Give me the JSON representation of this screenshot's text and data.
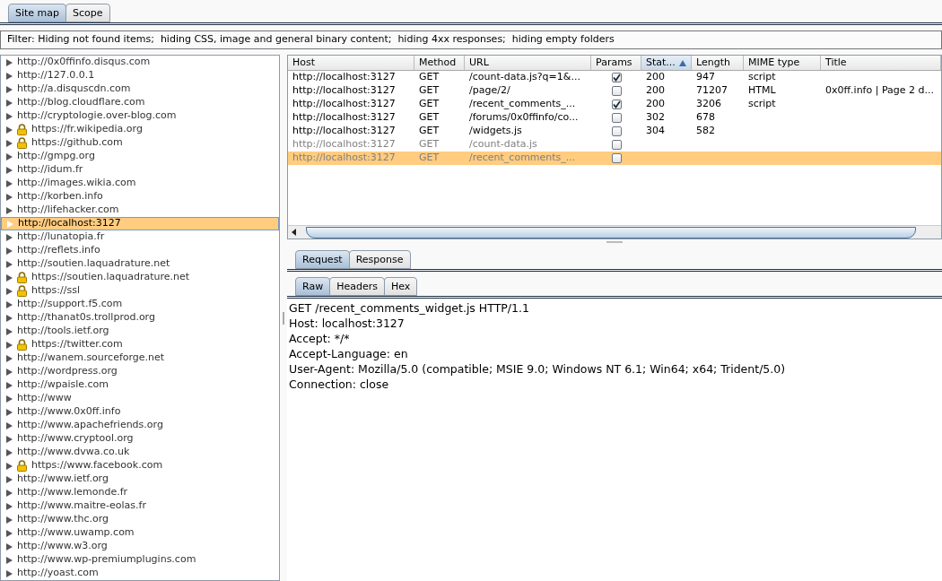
{
  "tabs": [
    {
      "label": "Site map",
      "selected": true
    },
    {
      "label": "Scope",
      "selected": false
    }
  ],
  "filter": "Filter: Hiding not found items;  hiding CSS, image and general binary content;  hiding 4xx responses;  hiding empty folders",
  "sites": [
    {
      "label": "http://0x0ffinfo.disqus.com",
      "secure": false,
      "selected": false
    },
    {
      "label": "http://127.0.0.1",
      "secure": false,
      "selected": false
    },
    {
      "label": "http://a.disquscdn.com",
      "secure": false,
      "selected": false
    },
    {
      "label": "http://blog.cloudflare.com",
      "secure": false,
      "selected": false
    },
    {
      "label": "http://cryptologie.over-blog.com",
      "secure": false,
      "selected": false
    },
    {
      "label": "https://fr.wikipedia.org",
      "secure": true,
      "selected": false
    },
    {
      "label": "https://github.com",
      "secure": true,
      "selected": false
    },
    {
      "label": "http://gmpg.org",
      "secure": false,
      "selected": false
    },
    {
      "label": "http://idum.fr",
      "secure": false,
      "selected": false
    },
    {
      "label": "http://images.wikia.com",
      "secure": false,
      "selected": false
    },
    {
      "label": "http://korben.info",
      "secure": false,
      "selected": false
    },
    {
      "label": "http://lifehacker.com",
      "secure": false,
      "selected": false
    },
    {
      "label": "http://localhost:3127",
      "secure": false,
      "selected": true
    },
    {
      "label": "http://lunatopia.fr",
      "secure": false,
      "selected": false
    },
    {
      "label": "http://reflets.info",
      "secure": false,
      "selected": false
    },
    {
      "label": "http://soutien.laquadrature.net",
      "secure": false,
      "selected": false
    },
    {
      "label": "https://soutien.laquadrature.net",
      "secure": true,
      "selected": false
    },
    {
      "label": "https://ssl",
      "secure": true,
      "selected": false
    },
    {
      "label": "http://support.f5.com",
      "secure": false,
      "selected": false
    },
    {
      "label": "http://thanat0s.trollprod.org",
      "secure": false,
      "selected": false
    },
    {
      "label": "http://tools.ietf.org",
      "secure": false,
      "selected": false
    },
    {
      "label": "https://twitter.com",
      "secure": true,
      "selected": false
    },
    {
      "label": "http://wanem.sourceforge.net",
      "secure": false,
      "selected": false
    },
    {
      "label": "http://wordpress.org",
      "secure": false,
      "selected": false
    },
    {
      "label": "http://wpaisle.com",
      "secure": false,
      "selected": false
    },
    {
      "label": "http://www",
      "secure": false,
      "selected": false
    },
    {
      "label": "http://www.0x0ff.info",
      "secure": false,
      "selected": false
    },
    {
      "label": "http://www.apachefriends.org",
      "secure": false,
      "selected": false
    },
    {
      "label": "http://www.cryptool.org",
      "secure": false,
      "selected": false
    },
    {
      "label": "http://www.dvwa.co.uk",
      "secure": false,
      "selected": false
    },
    {
      "label": "https://www.facebook.com",
      "secure": true,
      "selected": false
    },
    {
      "label": "http://www.ietf.org",
      "secure": false,
      "selected": false
    },
    {
      "label": "http://www.lemonde.fr",
      "secure": false,
      "selected": false
    },
    {
      "label": "http://www.maitre-eolas.fr",
      "secure": false,
      "selected": false
    },
    {
      "label": "http://www.thc.org",
      "secure": false,
      "selected": false
    },
    {
      "label": "http://www.uwamp.com",
      "secure": false,
      "selected": false
    },
    {
      "label": "http://www.w3.org",
      "secure": false,
      "selected": false
    },
    {
      "label": "http://www.wp-premiumplugins.com",
      "secure": false,
      "selected": false
    },
    {
      "label": "http://yoast.com",
      "secure": false,
      "selected": false
    }
  ],
  "table": {
    "columns": [
      {
        "label": "Host",
        "sorted": false
      },
      {
        "label": "Method",
        "sorted": false
      },
      {
        "label": "URL",
        "sorted": false
      },
      {
        "label": "Params",
        "sorted": false
      },
      {
        "label": "Stat...",
        "sorted": true
      },
      {
        "label": "Length",
        "sorted": false
      },
      {
        "label": "MIME type",
        "sorted": false
      },
      {
        "label": "Title",
        "sorted": false
      }
    ],
    "rows": [
      {
        "host": "http://localhost:3127",
        "method": "GET",
        "url": "/count-data.js?q=1&...",
        "params": true,
        "status": "200",
        "length": "947",
        "mime": "script",
        "title": "",
        "greyed": false,
        "selected": false
      },
      {
        "host": "http://localhost:3127",
        "method": "GET",
        "url": "/page/2/",
        "params": false,
        "status": "200",
        "length": "71207",
        "mime": "HTML",
        "title": "0x0ff.info | Page 2 d...",
        "greyed": false,
        "selected": false
      },
      {
        "host": "http://localhost:3127",
        "method": "GET",
        "url": "/recent_comments_...",
        "params": true,
        "status": "200",
        "length": "3206",
        "mime": "script",
        "title": "",
        "greyed": false,
        "selected": false
      },
      {
        "host": "http://localhost:3127",
        "method": "GET",
        "url": "/forums/0x0ffinfo/co...",
        "params": false,
        "status": "302",
        "length": "678",
        "mime": "",
        "title": "",
        "greyed": false,
        "selected": false
      },
      {
        "host": "http://localhost:3127",
        "method": "GET",
        "url": "/widgets.js",
        "params": false,
        "status": "304",
        "length": "582",
        "mime": "",
        "title": "",
        "greyed": false,
        "selected": false
      },
      {
        "host": "http://localhost:3127",
        "method": "GET",
        "url": "/count-data.js",
        "params": false,
        "status": "",
        "length": "",
        "mime": "",
        "title": "",
        "greyed": true,
        "selected": false
      },
      {
        "host": "http://localhost:3127",
        "method": "GET",
        "url": "/recent_comments_...",
        "params": false,
        "status": "",
        "length": "",
        "mime": "",
        "title": "",
        "greyed": true,
        "selected": true
      }
    ]
  },
  "message_tabs": [
    {
      "label": "Request",
      "selected": true
    },
    {
      "label": "Response",
      "selected": false
    }
  ],
  "view_tabs": [
    {
      "label": "Raw",
      "selected": true
    },
    {
      "label": "Headers",
      "selected": false
    },
    {
      "label": "Hex",
      "selected": false
    }
  ],
  "request_lines": [
    "GET /recent_comments_widget.js HTTP/1.1",
    "Host: localhost:3127",
    "Accept: */*",
    "Accept-Language: en",
    "User-Agent: Mozilla/5.0 (compatible; MSIE 9.0; Windows NT 6.1; Win64; x64; Trident/5.0)",
    "Connection: close"
  ]
}
